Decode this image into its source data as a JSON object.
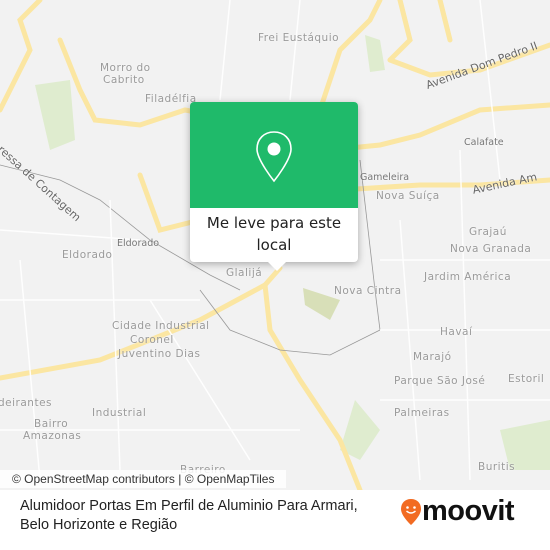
{
  "map": {
    "labels": {
      "frei_eustaquio": "Frei Eustáquio",
      "morro_do_cabrito_1": "Morro do",
      "morro_do_cabrito_2": "Cabrito",
      "filadelfia": "Filadélfia",
      "expressa_contagem": "Expressa de Contagem",
      "avenida_dom_pedro": "Avenida Dom Pedro II",
      "calafate": "Calafate",
      "gameleira": "Gameleira",
      "avenida_am": "Avenida Am",
      "nova_suica": "Nova Suíça",
      "grajau": "Grajaú",
      "nova_granada": "Nova Granada",
      "jardim_america": "Jardim América",
      "eldorado": "Eldorado",
      "eldorado_station": "Eldorado",
      "glalija": "Glalijá",
      "nova_cintra": "Nova Cintra",
      "cidade_industrial_1": "Cidade Industrial",
      "cidade_industrial_2": "Coronel",
      "cidade_industrial_3": "Juventino Dias",
      "havai": "Havaí",
      "marajo": "Marajó",
      "parque_sao_jose": "Parque São José",
      "estoril": "Estoril",
      "bandeirantes": "deirantes",
      "industrial": "Industrial",
      "bairro_amazonas_1": "Bairro",
      "bairro_amazonas_2": "Amazonas",
      "palmeiras": "Palmeiras",
      "buritis": "Buritis",
      "barreiro": "Barreiro"
    },
    "attribution": "© OpenStreetMap contributors | © OpenMapTiles",
    "colors": {
      "road": "#fbe6a2",
      "park": "#d9ebc8",
      "popup": "#1fba6a"
    }
  },
  "popup": {
    "icon": "map-pin-icon",
    "label": "Me leve para este local"
  },
  "footer": {
    "title_line1": "Alumidoor Portas Em Perfil de Aluminio Para Armari,",
    "title_line2": "Belo Horizonte e Região",
    "logo": "moovit"
  }
}
